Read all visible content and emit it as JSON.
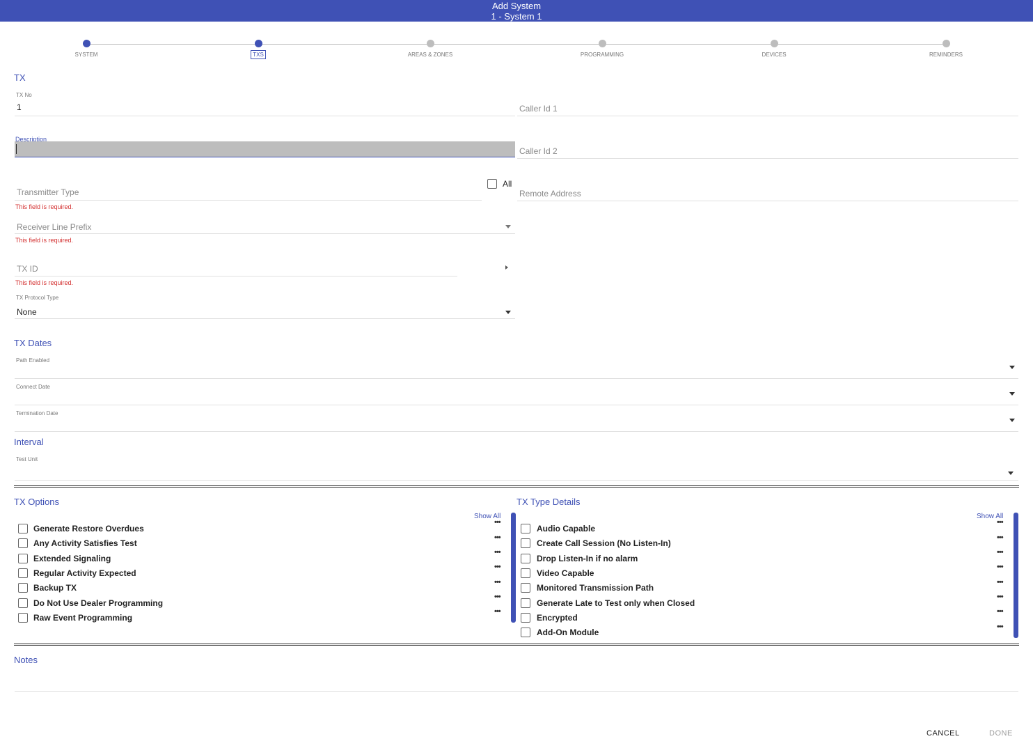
{
  "title": {
    "line1": "Add System",
    "line2": "1 - System 1"
  },
  "stepper": {
    "steps": [
      {
        "label": "SYSTEM",
        "state": "completed"
      },
      {
        "label": "TXS",
        "state": "current"
      },
      {
        "label": "AREAS & ZONES",
        "state": "pending"
      },
      {
        "label": "PROGRAMMING",
        "state": "pending"
      },
      {
        "label": "DEVICES",
        "state": "pending"
      },
      {
        "label": "REMINDERS",
        "state": "pending"
      }
    ]
  },
  "tx": {
    "section_title": "TX",
    "tx_no": {
      "label": "TX No",
      "value": "1"
    },
    "description": {
      "label": "Description",
      "value": ""
    },
    "transmitter_type": {
      "placeholder": "Transmitter Type",
      "error": "This field is required."
    },
    "all_checkbox": {
      "label": "All",
      "checked": false
    },
    "receiver_line_prefix": {
      "placeholder": "Receiver Line Prefix",
      "error": "This field is required."
    },
    "tx_id": {
      "placeholder": "TX ID",
      "error": "This field is required."
    },
    "tx_protocol_type": {
      "label": "TX Protocol Type",
      "value": "None"
    },
    "caller_id_1": {
      "placeholder": "Caller Id 1"
    },
    "caller_id_2": {
      "placeholder": "Caller Id 2"
    },
    "remote_address": {
      "placeholder": "Remote Address"
    }
  },
  "tx_dates": {
    "section_title": "TX Dates",
    "path_enabled": {
      "label": "Path Enabled"
    },
    "connect_date": {
      "label": "Connect Date"
    },
    "termination_date": {
      "label": "Termination Date"
    }
  },
  "interval": {
    "section_title": "Interval",
    "test_unit": {
      "label": "Test Unit"
    }
  },
  "tx_options": {
    "section_title": "TX Options",
    "show_all": "Show All",
    "items": [
      "Generate Restore Overdues",
      "Any Activity Satisfies Test",
      "Extended Signaling",
      "Regular Activity Expected",
      "Backup TX",
      "Do Not Use Dealer Programming",
      "Raw Event Programming"
    ]
  },
  "tx_type_details": {
    "section_title": "TX Type Details",
    "show_all": "Show All",
    "items": [
      "Audio Capable",
      "Create Call Session (No Listen-In)",
      "Drop Listen-In if no alarm",
      "Video Capable",
      "Monitored Transmission Path",
      "Generate Late to Test only when Closed",
      "Encrypted",
      "Add-On Module"
    ]
  },
  "notes": {
    "section_title": "Notes"
  },
  "footer": {
    "cancel": "CANCEL",
    "done": "DONE"
  },
  "colors": {
    "accent": "#3f51b5",
    "error": "#d32f2f"
  }
}
